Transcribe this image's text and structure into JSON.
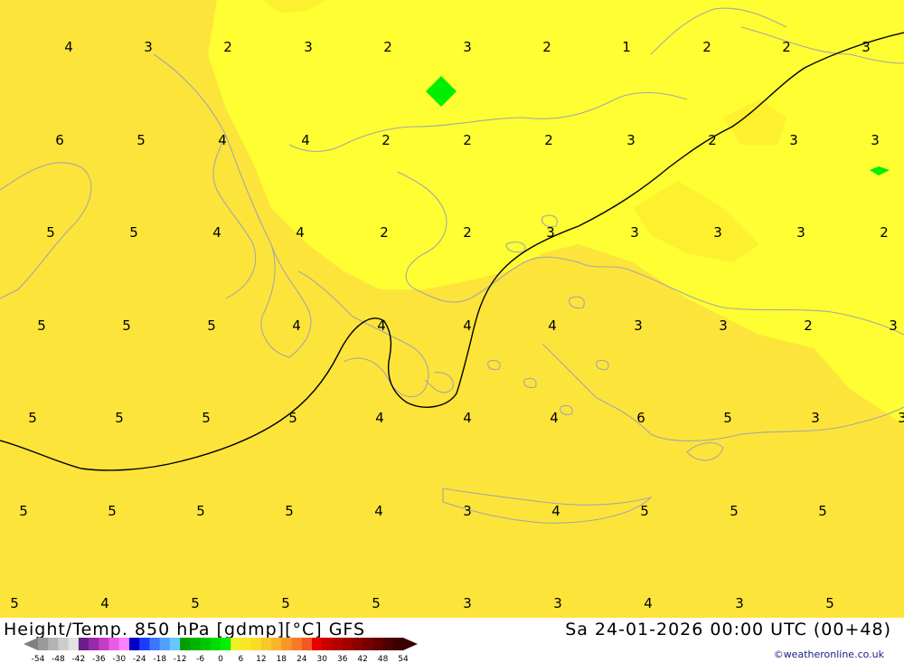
{
  "map": {
    "colors": {
      "zone_5_6": "#fde43a",
      "zone_2_4": "#fefe32",
      "zone_0_2": "#fefe32",
      "highlight_green": "#00ee00",
      "coastline": "#a7a7a7",
      "isotherm": "#000000"
    },
    "values": [
      "4",
      "3",
      "2",
      "3",
      "2",
      "3",
      "2",
      "1",
      "2",
      "2",
      "3",
      "6",
      "5",
      "4",
      "4",
      "2",
      "2",
      "2",
      "3",
      "2",
      "3",
      "3",
      "5",
      "5",
      "4",
      "4",
      "2",
      "2",
      "3",
      "3",
      "3",
      "3",
      "2",
      "5",
      "5",
      "5",
      "4",
      "4",
      "4",
      "4",
      "3",
      "3",
      "2",
      "3",
      "5",
      "5",
      "5",
      "5",
      "4",
      "4",
      "4",
      "6",
      "5",
      "3",
      "3",
      "5",
      "5",
      "5",
      "5",
      "4",
      "3",
      "4",
      "5",
      "5",
      "5",
      "5",
      "4",
      "5",
      "5",
      "5",
      "3",
      "3",
      "4",
      "3",
      "5"
    ]
  },
  "footer": {
    "title": "Height/Temp. 850 hPa [gdmp][°C] GFS",
    "datetime": "Sa 24-01-2026 00:00 UTC (00+48)",
    "credit": "©weatheronline.co.uk"
  },
  "legend": {
    "ticks": [
      "-54",
      "-48",
      "-42",
      "-36",
      "-30",
      "-24",
      "-18",
      "-12",
      "-6",
      "0",
      "6",
      "12",
      "18",
      "24",
      "30",
      "36",
      "42",
      "48",
      "54"
    ],
    "swatches": [
      "#9a9a9a",
      "#b4b4b4",
      "#cccccc",
      "#e2e2e2",
      "#6a1f8a",
      "#9a2aaa",
      "#c43cc8",
      "#ea5aea",
      "#ff80ff",
      "#0000c8",
      "#1e3cff",
      "#3c78ff",
      "#50a0ff",
      "#64c8ff",
      "#00a000",
      "#00b400",
      "#00c800",
      "#00dc00",
      "#00f000",
      "#f0f028",
      "#fae628",
      "#fadc28",
      "#fac828",
      "#fab428",
      "#fa9628",
      "#fa7828",
      "#f05a1e",
      "#e60000",
      "#c80000",
      "#b40000",
      "#a00000",
      "#8c0000",
      "#780000",
      "#640000",
      "#500000",
      "#3c0000"
    ]
  }
}
